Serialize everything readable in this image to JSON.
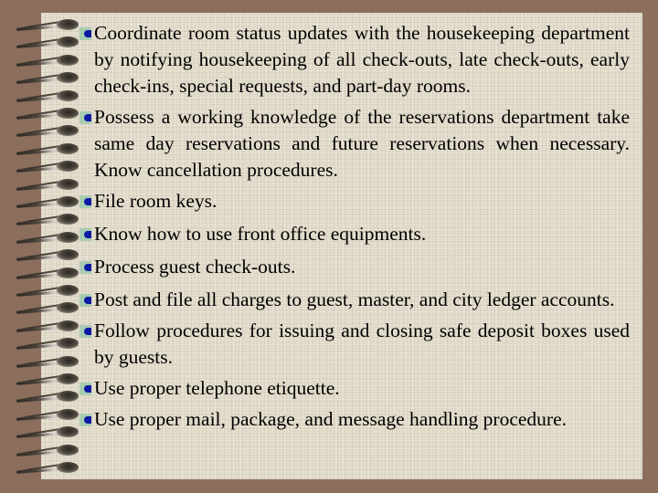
{
  "slide": {
    "bullet_icon": "square-bullet-icon",
    "colors": {
      "background": "#8b6e5c",
      "paper": "#e2dbc9",
      "bullet_square": "#a9ccb2",
      "bullet_dot": "#0a1aa3",
      "text": "#000000"
    },
    "items": [
      {
        "text": "Coordinate room status updates with the housekeeping department by notifying housekeeping of all check-outs, late check-outs, early check-ins, special requests, and part-day rooms."
      },
      {
        "text": "Possess a working knowledge of the reservations department take same day reservations and future reservations when necessary. Know cancellation procedures."
      },
      {
        "text": "File room keys."
      },
      {
        "text": "Know how to use front office equipments."
      },
      {
        "text": "Process guest check-outs."
      },
      {
        "text": "Post and file all charges to guest, master, and city ledger accounts."
      },
      {
        "text": "Follow procedures for issuing and closing safe deposit boxes used by guests."
      },
      {
        "text": "Use proper telephone etiquette."
      },
      {
        "text": "Use proper mail, package, and message handling procedure."
      }
    ]
  }
}
